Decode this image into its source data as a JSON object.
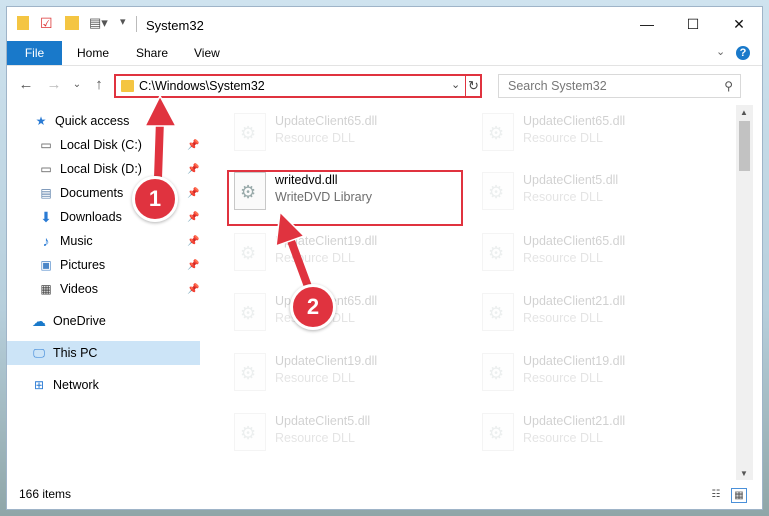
{
  "window": {
    "title": "System32",
    "controls": {
      "minimize": "—",
      "maximize": "☐",
      "close": "✕"
    }
  },
  "ribbon": {
    "tabs": [
      "File",
      "Home",
      "Share",
      "View"
    ],
    "help": "?"
  },
  "address": {
    "path": "C:\\Windows\\System32"
  },
  "search": {
    "placeholder": "Search System32"
  },
  "sidebar": {
    "quick_access": "Quick access",
    "items": [
      {
        "label": "Local Disk (C:)"
      },
      {
        "label": "Local Disk (D:)"
      },
      {
        "label": "Documents"
      },
      {
        "label": "Downloads"
      },
      {
        "label": "Music"
      },
      {
        "label": "Pictures"
      },
      {
        "label": "Videos"
      }
    ],
    "onedrive": "OneDrive",
    "this_pc": "This PC",
    "network": "Network"
  },
  "files": {
    "highlighted": {
      "name": "writedvd.dll",
      "type": "WriteDVD Library"
    },
    "background": [
      {
        "name": "UpdateClient65.dll",
        "type": "Resource DLL"
      },
      {
        "name": "UpdateClient65.dll",
        "type": "Resource DLL"
      },
      {
        "name": "UpdateClient5.dll",
        "type": "Resource DLL"
      },
      {
        "name": "UpdateClient19.dll",
        "type": "Resource DLL"
      },
      {
        "name": "UpdateClient65.dll",
        "type": "Resource DLL"
      },
      {
        "name": "UpdateClient65.dll",
        "type": "Resource DLL"
      },
      {
        "name": "UpdateClient21.dll",
        "type": "Resource DLL"
      },
      {
        "name": "UpdateClient19.dll",
        "type": "Resource DLL"
      },
      {
        "name": "UpdateClient19.dll",
        "type": "Resource DLL"
      },
      {
        "name": "UpdateClient5.dll",
        "type": "Resource DLL"
      },
      {
        "name": "UpdateClient21.dll",
        "type": "Resource DLL"
      }
    ]
  },
  "status": {
    "items": "166 items"
  },
  "callouts": {
    "one": "1",
    "two": "2"
  },
  "colors": {
    "accent": "#1979ca",
    "annotation": "#e0333f",
    "selection": "#cce4f7"
  }
}
